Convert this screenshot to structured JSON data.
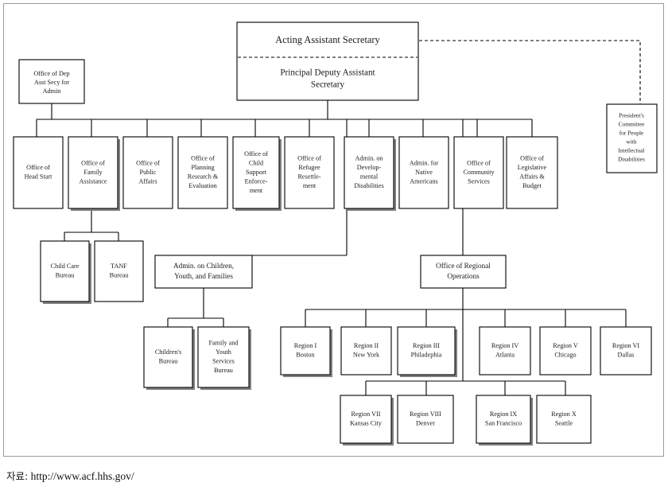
{
  "chart": {
    "title_boxes": {
      "acting_assistant_secretary": "Acting Assistant Secretary",
      "principal_deputy_line1": "Principal Deputy Assistant",
      "principal_deputy_line2": "Secretary"
    },
    "staff_office": {
      "line1": "Office of Dep",
      "line2": "Asst Secy for",
      "line3": "Admin"
    },
    "advisory_box": {
      "line1": "President's",
      "line2": "Committee",
      "line3": "for People",
      "line4": "with",
      "line5": "Intellectual",
      "line6": "Disabilities"
    },
    "level2_offices": [
      {
        "id": "office-head-start",
        "lines": [
          "Office of",
          "Head Start"
        ]
      },
      {
        "id": "office-family-assistance",
        "lines": [
          "Office of",
          "Family",
          "Assistance"
        ]
      },
      {
        "id": "office-public-affairs",
        "lines": [
          "Office of",
          "Public",
          "Affairs"
        ]
      },
      {
        "id": "office-planning-research-evaluation",
        "lines": [
          "Office of",
          "Planning",
          "Research &",
          "Evaluation"
        ]
      },
      {
        "id": "office-child-support-enforcement",
        "lines": [
          "Office of",
          "Child",
          "Support",
          "Enforce-",
          "ment"
        ]
      },
      {
        "id": "office-refugee-resettlement",
        "lines": [
          "Office of",
          "Refugee",
          "Resettle-",
          "ment"
        ]
      },
      {
        "id": "admin-developmental-disabilities",
        "lines": [
          "Admin. on",
          "Develop-",
          "mental",
          "Disabilities"
        ]
      },
      {
        "id": "admin-native-americans",
        "lines": [
          "Admin. for",
          "Native",
          "Americans"
        ]
      },
      {
        "id": "office-community-services",
        "lines": [
          "Office of",
          "Community",
          "Services"
        ]
      },
      {
        "id": "office-legislative-affairs-budget",
        "lines": [
          "Office of",
          "Legislative",
          "Affairs &",
          "Budget"
        ]
      }
    ],
    "level3_bureaus": [
      {
        "id": "child-care-bureau",
        "lines": [
          "Child Care",
          "Bureau"
        ]
      },
      {
        "id": "tanf-bureau",
        "lines": [
          "TANF",
          "Bureau"
        ]
      }
    ],
    "acyf": {
      "id": "admin-children-youth-families",
      "lines": [
        "Admin. on Children,",
        "Youth, and Families"
      ]
    },
    "acyf_children": [
      {
        "id": "childrens-bureau",
        "lines": [
          "Children's",
          "Bureau"
        ]
      },
      {
        "id": "family-youth-services-bureau",
        "lines": [
          "Family and",
          "Youth",
          "Services",
          "Bureau"
        ]
      }
    ],
    "regional_operations": {
      "id": "office-regional-operations",
      "lines": [
        "Office of Regional",
        "Operations"
      ]
    },
    "regions_row1": [
      {
        "id": "region-1",
        "lines": [
          "Region I",
          "Boston"
        ]
      },
      {
        "id": "region-2",
        "lines": [
          "Region II",
          "New York"
        ]
      },
      {
        "id": "region-3",
        "lines": [
          "Region III",
          "Philadephia"
        ]
      },
      {
        "id": "region-4",
        "lines": [
          "Region IV",
          "Atlanta"
        ]
      },
      {
        "id": "region-5",
        "lines": [
          "Region V",
          "Chicago"
        ]
      },
      {
        "id": "region-6",
        "lines": [
          "Region VI",
          "Dallas"
        ]
      }
    ],
    "regions_row2": [
      {
        "id": "region-7",
        "lines": [
          "Region VII",
          "Kansas City"
        ]
      },
      {
        "id": "region-8",
        "lines": [
          "Region VIII",
          "Denver"
        ]
      },
      {
        "id": "region-9",
        "lines": [
          "Region IX",
          "San Francisco"
        ]
      },
      {
        "id": "region-10",
        "lines": [
          "Region X",
          "Seattle"
        ]
      }
    ]
  },
  "source": {
    "label": "자료:",
    "url": "http://www.acf.hhs.gov/"
  },
  "colors": {
    "box_stroke": "#000000",
    "box_fill": "#ffffff",
    "shadow": "#808080",
    "frame": "#9a9a9a",
    "text": "#1a1a1a"
  }
}
